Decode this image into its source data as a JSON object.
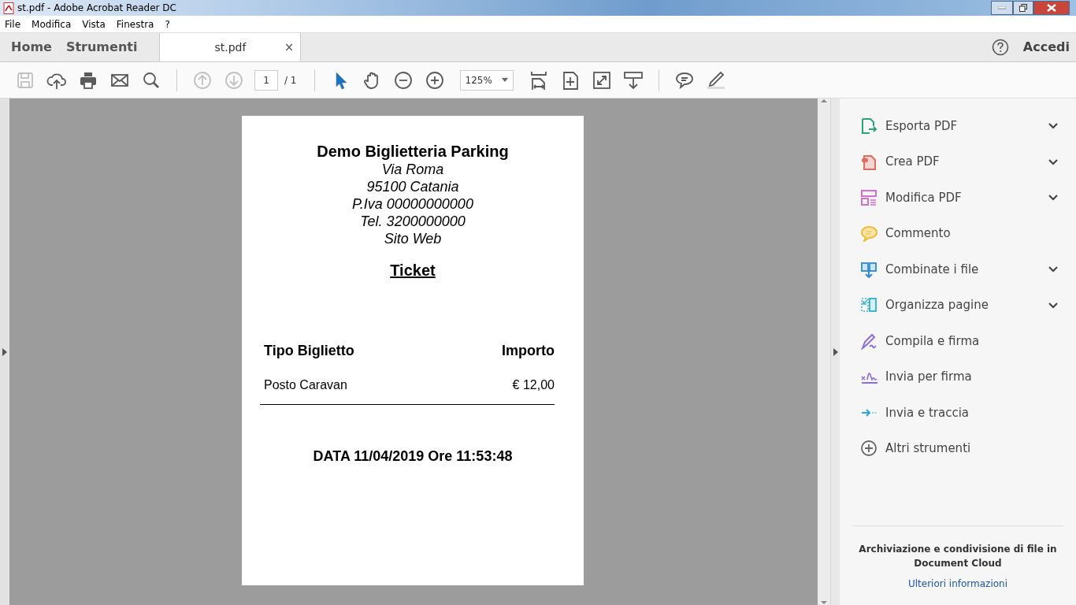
{
  "window": {
    "title": "st.pdf - Adobe Acrobat Reader DC"
  },
  "menu": [
    "File",
    "Modifica",
    "Vista",
    "Finestra",
    "?"
  ],
  "tabs": [
    {
      "label": "Home",
      "kind": "nav",
      "selected": false
    },
    {
      "label": "Strumenti",
      "kind": "nav",
      "selected": false
    },
    {
      "label": "st.pdf",
      "kind": "document",
      "selected": true,
      "close": "×"
    }
  ],
  "account": {
    "label": "Accedi"
  },
  "toolbar": [
    {
      "items": [
        {
          "kind": "save",
          "disabled": true
        },
        {
          "kind": "upload",
          "disabled": false
        },
        {
          "kind": "print",
          "disabled": false
        },
        {
          "kind": "mail",
          "disabled": false
        },
        {
          "kind": "search",
          "disabled": false
        }
      ]
    },
    {
      "items": [
        {
          "kind": "prev",
          "disabled": true
        },
        {
          "kind": "next",
          "disabled": true
        },
        {
          "kind": "page",
          "disabled": false,
          "value": "1",
          "total": "/ 1"
        }
      ]
    },
    {
      "items": [
        {
          "kind": "select",
          "disabled": false
        },
        {
          "kind": "hand",
          "disabled": false
        },
        {
          "kind": "zoomout",
          "disabled": false
        },
        {
          "kind": "zoomin",
          "disabled": false
        },
        {
          "kind": "zoom",
          "disabled": false,
          "value": "125%"
        },
        {
          "kind": "fitwidth",
          "disabled": false
        },
        {
          "kind": "fitpage",
          "disabled": false
        },
        {
          "kind": "fullscreen",
          "disabled": false
        },
        {
          "kind": "readmode",
          "disabled": false
        }
      ]
    },
    {
      "items": [
        {
          "kind": "comment",
          "disabled": false
        },
        {
          "kind": "highlight",
          "disabled": false
        }
      ]
    }
  ],
  "document": {
    "header": [
      {
        "text": "Demo Biglietteria Parking",
        "kind": "title"
      },
      {
        "text": "Via Roma",
        "kind": "italic"
      },
      {
        "text": "95100  Catania",
        "kind": "italic"
      },
      {
        "text": "P.Iva 00000000000",
        "kind": "italic"
      },
      {
        "text": "Tel. 3200000000",
        "kind": "italic"
      },
      {
        "text": "Sito Web",
        "kind": "italic"
      }
    ],
    "heading": "Ticket",
    "columns": [
      "Tipo Biglietto",
      "Importo"
    ],
    "rows": [
      [
        "Posto Caravan",
        "€ 12,00"
      ]
    ],
    "footer": "DATA 11/04/2019 Ore 11:53:48"
  },
  "tools": [
    {
      "label": "Esporta PDF",
      "kind": "export",
      "expandable": true
    },
    {
      "label": "Crea PDF",
      "kind": "create",
      "expandable": true
    },
    {
      "label": "Modifica PDF",
      "kind": "edit",
      "expandable": true
    },
    {
      "label": "Commento",
      "kind": "comment",
      "expandable": false
    },
    {
      "label": "Combinate i file",
      "kind": "combine",
      "expandable": true
    },
    {
      "label": "Organizza pagine",
      "kind": "organize",
      "expandable": true
    },
    {
      "label": "Compila e firma",
      "kind": "fillsign",
      "expandable": false
    },
    {
      "label": "Invia per firma",
      "kind": "sendsign",
      "expandable": false
    },
    {
      "label": "Invia e traccia",
      "kind": "sendtrack",
      "expandable": false
    },
    {
      "label": "Altri strumenti",
      "kind": "more",
      "expandable": false
    }
  ],
  "cloud": {
    "text": "Archiviazione e condivisione di file in Document Cloud",
    "link": "Ulteriori informazioni"
  }
}
